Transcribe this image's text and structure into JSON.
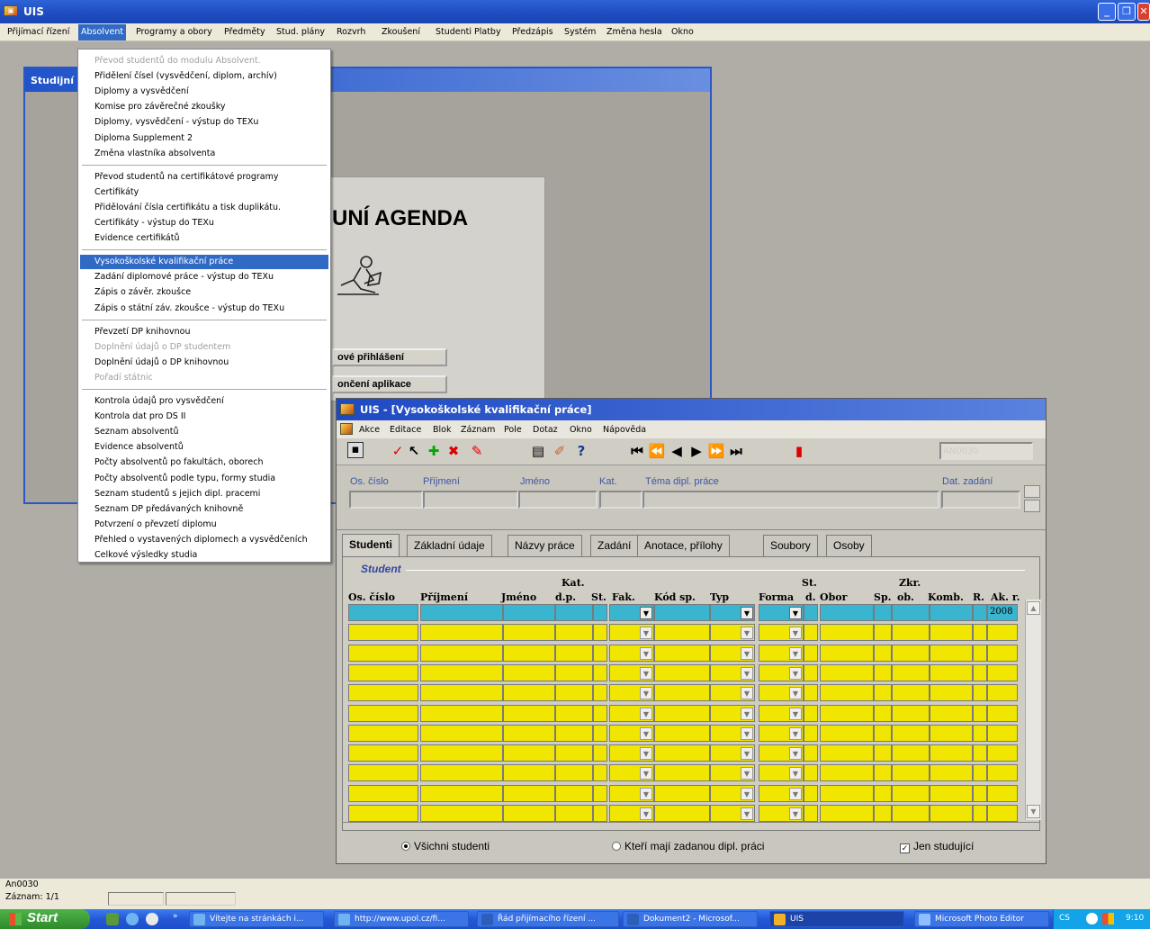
{
  "app": {
    "title": "UIS",
    "window_buttons": [
      "minimize-icon",
      "restore-icon",
      "close-icon"
    ]
  },
  "menubar": [
    {
      "label": "Přijímací řízení"
    },
    {
      "label": "Absolvent",
      "active": true
    },
    {
      "label": "Programy a obory"
    },
    {
      "label": "Předměty"
    },
    {
      "label": "Stud. plány"
    },
    {
      "label": "Rozvrh"
    },
    {
      "label": "Zkoušení"
    },
    {
      "label": "Studenti"
    },
    {
      "label": "Platby"
    },
    {
      "label": "Předzápis"
    },
    {
      "label": "Systém"
    },
    {
      "label": "Změna hesla"
    },
    {
      "label": "Okno"
    }
  ],
  "background_window": {
    "title": "Studijní",
    "agenda_title": "UNÍ AGENDA",
    "button1": "ové přihlášení",
    "button2": "ončení aplikace"
  },
  "dropdown": {
    "groups": [
      [
        {
          "label": "Převod studentů do modulu Absolvent.",
          "disabled": true
        },
        {
          "label": "Přidělení čísel (vysvědčení, diplom, archív)"
        },
        {
          "label": "Diplomy a vysvědčení"
        },
        {
          "label": "Komise pro závěrečné zkoušky"
        },
        {
          "label": "Diplomy, vysvědčení - výstup do TEXu"
        },
        {
          "label": "Diploma Supplement 2"
        },
        {
          "label": "Změna vlastníka absolventa"
        }
      ],
      [
        {
          "label": "Převod studentů na certifikátové programy"
        },
        {
          "label": "Certifikáty"
        },
        {
          "label": "Přidělování čísla certifikátu a tisk duplikátu."
        },
        {
          "label": "Certifikáty - výstup do TEXu"
        },
        {
          "label": "Evidence certifikátů"
        }
      ],
      [
        {
          "label": "Vysokoškolské kvalifikační práce",
          "highlighted": true
        },
        {
          "label": "Zadání diplomové práce - výstup do TEXu"
        },
        {
          "label": "Zápis o závěr. zkoušce"
        },
        {
          "label": "Zápis o státní záv. zkoušce - výstup do TEXu"
        }
      ],
      [
        {
          "label": "Převzetí DP knihovnou"
        },
        {
          "label": "Doplnění údajů o DP studentem",
          "disabled": true
        },
        {
          "label": "Doplnění údajů o DP knihovnou"
        },
        {
          "label": "Pořadí státnic",
          "disabled": true
        }
      ],
      [
        {
          "label": "Kontrola údajů pro vysvědčení"
        },
        {
          "label": "Kontrola dat pro DS II"
        },
        {
          "label": "Seznam absolventů"
        },
        {
          "label": "Evidence absolventů"
        },
        {
          "label": "Počty absolventů po fakultách, oborech"
        },
        {
          "label": "Počty absolventů podle typu, formy studia"
        },
        {
          "label": "Seznam studentů s jejich dipl. pracemi"
        },
        {
          "label": "Seznam DP předávaných knihovně"
        },
        {
          "label": "Potvrzení o převzetí diplomu"
        },
        {
          "label": "Přehled o vystavených diplomech a vysvědčeních"
        },
        {
          "label": "Celkové výsledky studia"
        }
      ]
    ]
  },
  "vkp": {
    "title": "UIS - [Vysokoškolské kvalifikační práce]",
    "menu": [
      "Akce",
      "Editace",
      "Blok",
      "Záznam",
      "Pole",
      "Dotaz",
      "Okno",
      "Nápověda"
    ],
    "form_code": "AN0030",
    "query_labels": {
      "os_cislo": "Os. číslo",
      "prijmeni": "Příjmení",
      "jmeno": "Jméno",
      "kat": "Kat.",
      "tema": "Téma dipl. práce",
      "dat_zadani": "Dat. zadání"
    },
    "tabs": [
      "Studenti",
      "Základní údaje",
      "Názvy práce",
      "Zadání",
      "Anotace, přílohy",
      "Soubory",
      "Osoby"
    ],
    "group_label": "Student",
    "columns": {
      "os_cislo": "Os. číslo",
      "prijmeni": "Příjmení",
      "jmeno": "Jméno",
      "kat_top": "Kat.",
      "kat_bot": "d.p.",
      "st": "St.",
      "fak": "Fak.",
      "kod_sp": "Kód sp.",
      "typ": "Typ",
      "forma": "Forma",
      "std_top": "St.",
      "std_bot": "d.",
      "obor": "Obor",
      "sp": "Sp.",
      "zkr_top": "Zkr.",
      "zkr_bot": "ob.",
      "komb": "Komb.",
      "r": "R.",
      "ak_r": "Ak. r."
    },
    "first_row_year": "2008",
    "row_count": 11,
    "radios": {
      "all": "Všichni studenti",
      "assigned": "Kteří mají zadanou dipl. práci",
      "only_studying": "Jen studující"
    },
    "selected_radio": "all",
    "only_studying_checked": true
  },
  "status": {
    "line1": "An0030",
    "line2": "Záznam: 1/1"
  },
  "taskbar": {
    "start": "Start",
    "buttons": [
      {
        "label": "Vítejte na stránkách i..."
      },
      {
        "label": "http://www.upol.cz/fi..."
      },
      {
        "label": "Řád přijímacího řízení ..."
      },
      {
        "label": "Dokument2 - Microsof..."
      },
      {
        "label": "UIS",
        "active": true
      },
      {
        "label": "Microsoft Photo Editor"
      }
    ],
    "lang": "CS",
    "clock": "9:10"
  },
  "colors": {
    "accent": "#316ac5",
    "row_yellow": "#f0e600",
    "row_current": "#39b5cf",
    "label_blue": "#3d56a5"
  }
}
